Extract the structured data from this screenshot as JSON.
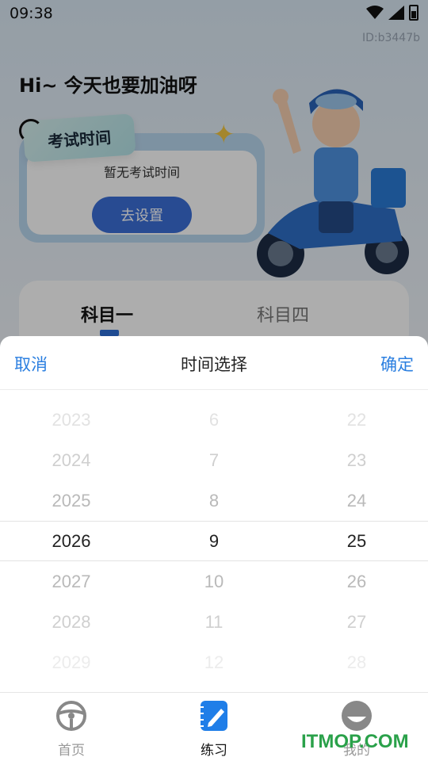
{
  "status_bar": {
    "time": "09:38"
  },
  "device_id": "ID:b3447b",
  "greeting": "Hi~ 今天也要加油呀",
  "exam_card": {
    "tag": "考试时间",
    "empty_text": "暂无考试时间",
    "button": "去设置"
  },
  "subject_tabs": {
    "tab1": "科目一",
    "tab2": "科目四"
  },
  "picker": {
    "cancel": "取消",
    "title": "时间选择",
    "confirm": "确定",
    "years": [
      "2023",
      "2024",
      "2025",
      "2026",
      "2027",
      "2028",
      "2029"
    ],
    "months": [
      "6",
      "7",
      "8",
      "9",
      "10",
      "11",
      "12"
    ],
    "days": [
      "22",
      "23",
      "24",
      "25",
      "26",
      "27",
      "28"
    ],
    "selected": {
      "year": "2026",
      "month": "9",
      "day": "25"
    }
  },
  "nav": {
    "home": "首页",
    "practice": "练习",
    "mine": "我的"
  },
  "watermark": "ITMOP.COM",
  "colors": {
    "accent": "#2b7fe0",
    "button": "#3b6fd8",
    "watermark": "#2aa14a"
  }
}
